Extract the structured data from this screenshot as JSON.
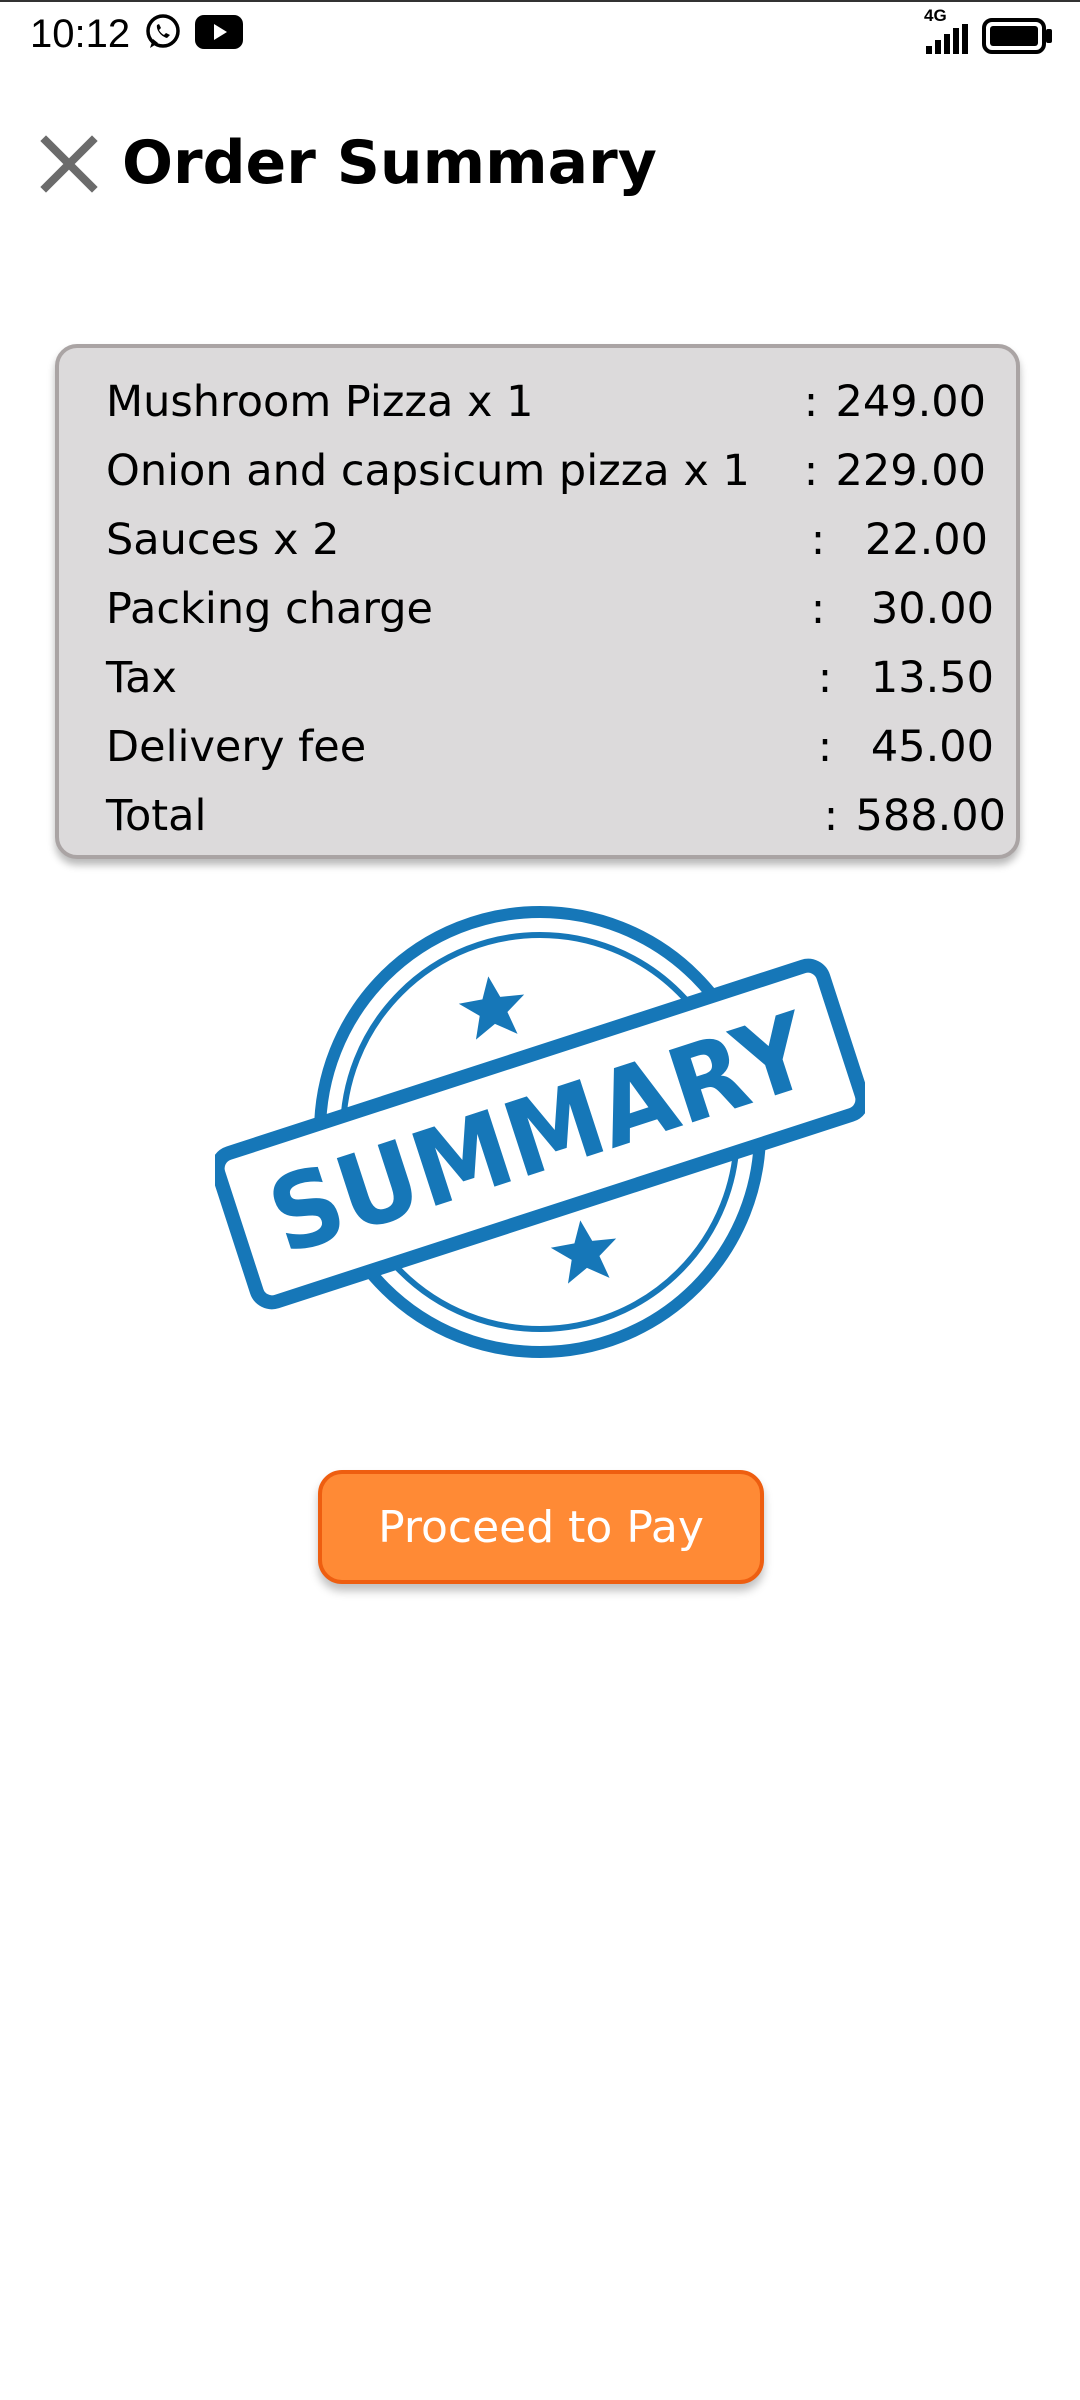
{
  "status_bar": {
    "time": "10:12",
    "network": "4G",
    "icons": [
      "whatsapp-icon",
      "youtube-icon",
      "signal-icon",
      "battery-icon"
    ]
  },
  "header": {
    "title": "Order Summary",
    "close_icon": "close-icon"
  },
  "order": {
    "items": [
      {
        "label": "Mushroom Pizza x 1",
        "separator": ":",
        "amount": "249.00"
      },
      {
        "label": "Onion and capsicum pizza x 1",
        "separator": ":",
        "amount": "229.00"
      },
      {
        "label": "Sauces x 2",
        "separator": ":",
        "amount": "22.00"
      },
      {
        "label": "Packing charge",
        "separator": ":",
        "amount": "30.00"
      },
      {
        "label": "Tax",
        "separator": ":",
        "amount": "13.50"
      },
      {
        "label": "Delivery fee",
        "separator": ":",
        "amount": "45.00"
      },
      {
        "label": "Total",
        "separator": ":",
        "amount": "588.00"
      }
    ]
  },
  "stamp": {
    "text": "SUMMARY",
    "color": "#1677b8"
  },
  "actions": {
    "pay_label": "Proceed to Pay",
    "pay_color": "#ff8a35"
  }
}
